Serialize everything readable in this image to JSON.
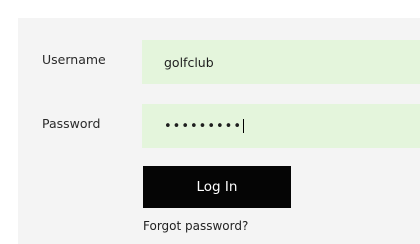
{
  "form": {
    "username_label": "Username",
    "username_value": "golfclub",
    "password_label": "Password",
    "password_value": "•••••••••",
    "login_label": "Log In",
    "forgot_label": "Forgot password?"
  },
  "colors": {
    "panel_bg": "#f4f4f4",
    "field_bg": "#e4f5dc",
    "button_bg": "#050505",
    "button_text": "#ffffff"
  }
}
